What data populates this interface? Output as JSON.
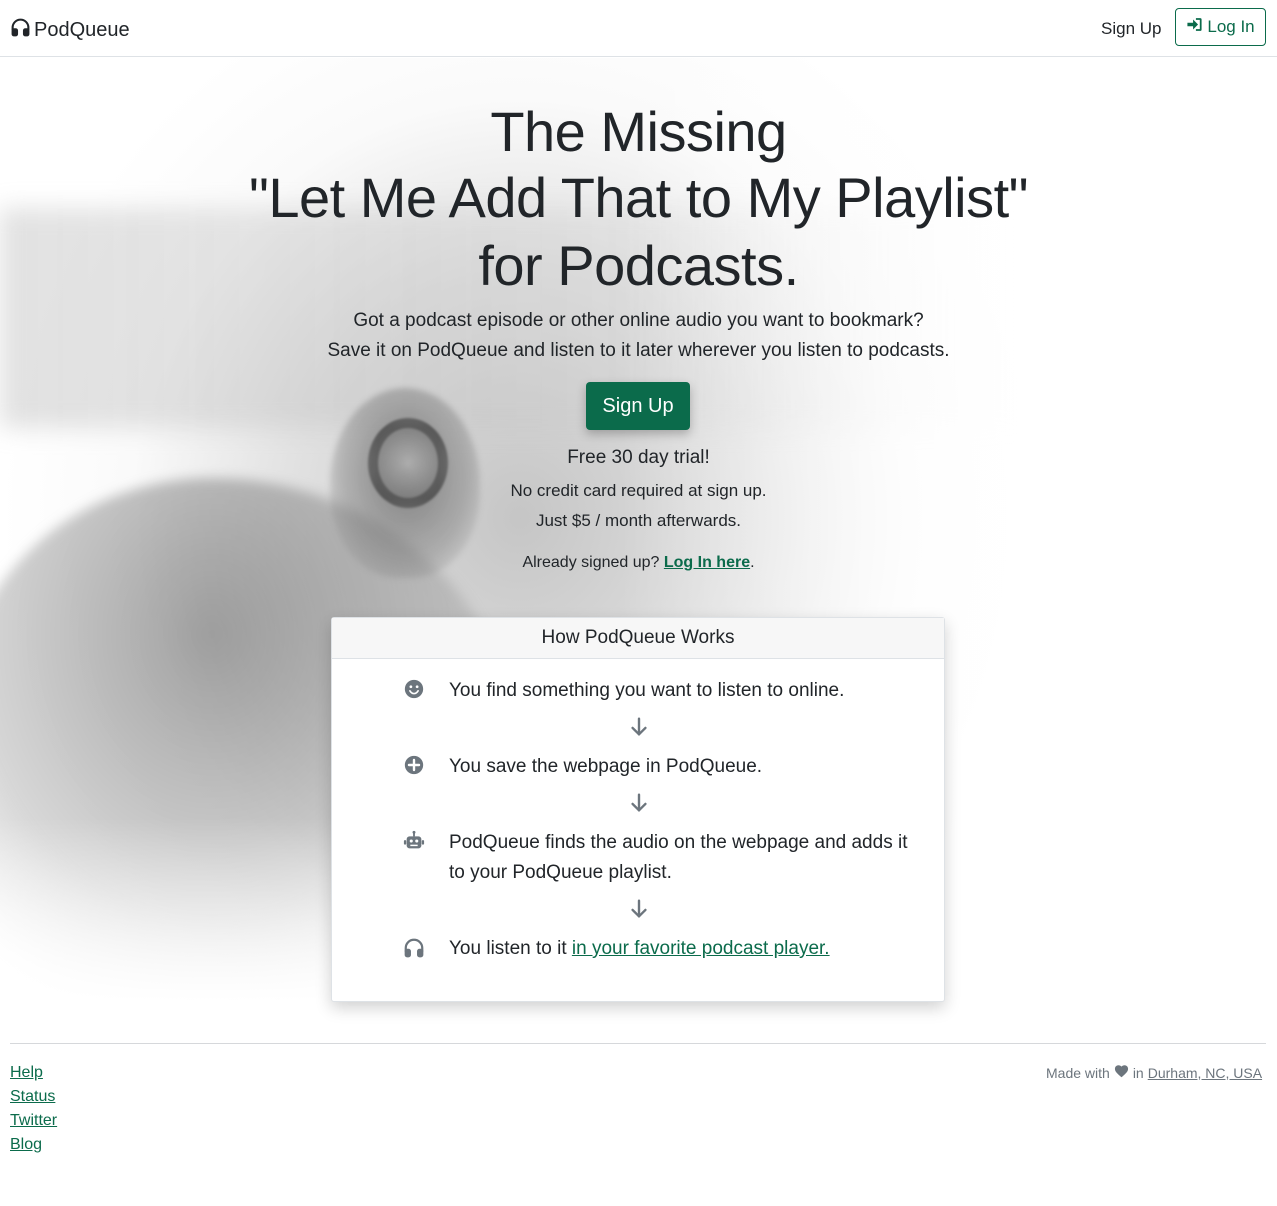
{
  "navbar": {
    "brand": "PodQueue",
    "brand_icon": "headphones-icon",
    "signup_label": "Sign Up",
    "login_label": "Log In",
    "login_icon": "sign-in-icon"
  },
  "hero": {
    "title_lines": [
      "The Missing",
      "\"Let Me Add That to My Playlist\"",
      "for Podcasts."
    ],
    "lead_lines": [
      "Got a podcast episode or other online audio you want to bookmark?",
      "Save it on PodQueue and listen to it later wherever you listen to podcasts."
    ],
    "signup_button": "Sign Up",
    "trial": "Free 30 day trial!",
    "no_card": "No credit card required at sign up.",
    "price": "Just $5 / month afterwards.",
    "already_prefix": "Already signed up? ",
    "already_link": "Log In here",
    "already_suffix": "."
  },
  "how_it_works": {
    "title": "How PodQueue Works",
    "steps": [
      {
        "icon": "smile-icon",
        "text": "You find something you want to listen to online."
      },
      {
        "icon": "plus-circle-icon",
        "text": "You save the webpage in PodQueue."
      },
      {
        "icon": "robot-icon",
        "text": "PodQueue finds the audio on the webpage and adds it to your PodQueue playlist."
      },
      {
        "icon": "headphones-icon",
        "text_prefix": "You listen to it ",
        "link": "in your favorite podcast player."
      }
    ],
    "arrow_icon": "arrow-down-icon"
  },
  "footer": {
    "links": [
      "Help",
      "Status",
      "Twitter",
      "Blog"
    ],
    "made_prefix": "Made with",
    "made_icon": "heart-icon",
    "made_in": "in",
    "location": "Durham, NC, USA"
  },
  "colors": {
    "accent": "#0b6b4b",
    "muted": "#6c757d",
    "text": "#212529"
  }
}
